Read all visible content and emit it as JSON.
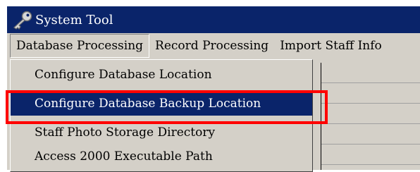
{
  "window": {
    "title": "System Tool",
    "title_icon": "key-icon"
  },
  "menubar": {
    "items": [
      {
        "label": "Database Processing",
        "state": "open"
      },
      {
        "label": "Record Processing"
      },
      {
        "label": "Import Staff Info"
      }
    ]
  },
  "dropdown": {
    "items": [
      {
        "label": "Configure Database Location"
      },
      {
        "label": "Configure Database Backup Location",
        "selected": true
      },
      {
        "label": "Staff Photo Storage Directory"
      },
      {
        "label": "Access 2000 Executable Path"
      }
    ]
  },
  "colors": {
    "titlebar": "#0a246a",
    "selection": "#0a246a",
    "highlight_box": "#ff0000",
    "face": "#d4d0c8"
  }
}
